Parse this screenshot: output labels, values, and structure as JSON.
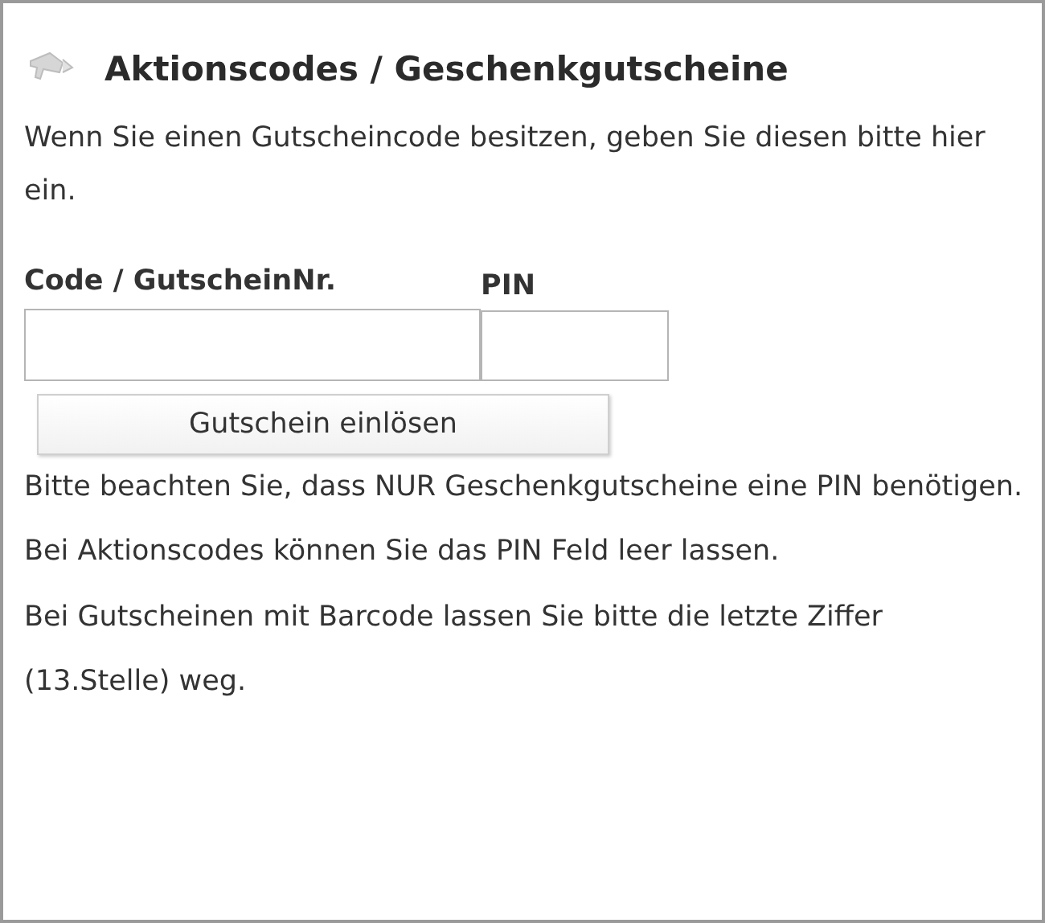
{
  "title": "Aktionscodes / Geschenkgutscheine",
  "intro": "Wenn Sie einen Gutscheincode besitzen, geben Sie diesen bitte hier ein.",
  "fields": [
    {
      "label": "Code / GutscheinNr.",
      "kind": "wide"
    },
    {
      "label": "PIN",
      "kind": "narrow"
    }
  ],
  "button": "Gutschein einlösen",
  "notes": [
    "Bitte beachten Sie, dass NUR Geschenkgutscheine eine PIN benötigen. Bei Aktionscodes können Sie das PIN Feld leer lassen.",
    "Bei Gutscheinen mit Barcode lassen Sie bitte die letzte Ziffer (13.Stelle) weg."
  ]
}
